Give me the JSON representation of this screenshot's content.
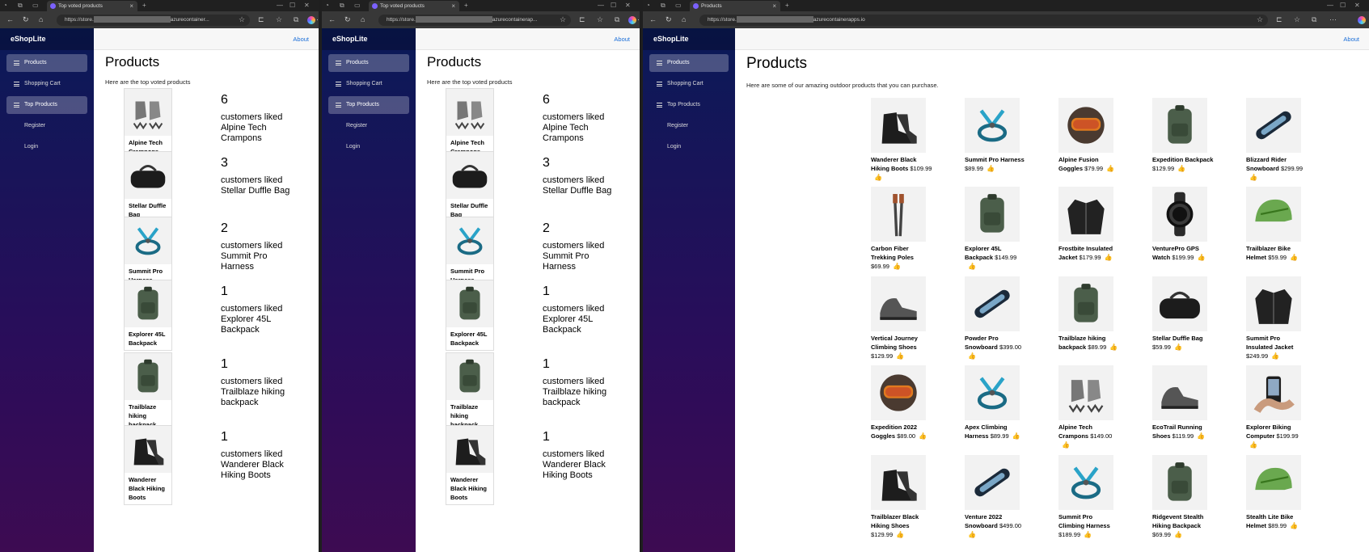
{
  "colors": {
    "accent": "#1a6ed8",
    "sidebar_top": "#0a1a58",
    "sidebar_bottom": "#3d0b52",
    "active_nav": "#4a4f86"
  },
  "windows": [
    {
      "tab_title": "Top voted products",
      "url_prefix": "https://store.",
      "url_suffix": "azurecontainer...",
      "brand": "eShopLite",
      "about": "About",
      "nav": [
        {
          "label": "Products",
          "icon": "menu-icon",
          "active": true
        },
        {
          "label": "Shopping Cart",
          "icon": "menu-icon",
          "active": false
        },
        {
          "label": "Top Products",
          "icon": "menu-icon",
          "active": true
        },
        {
          "label": "Register",
          "icon": "",
          "active": false
        },
        {
          "label": "Login",
          "icon": "",
          "active": false
        }
      ],
      "title": "Products",
      "subtitle": "Here are the top voted products",
      "top_voted": [
        {
          "name": "Alpine Tech Crampons",
          "count": "6",
          "liked_text": "customers liked"
        },
        {
          "name": "Stellar Duffle Bag",
          "count": "3",
          "liked_text": "customers liked"
        },
        {
          "name": "Summit Pro Harness",
          "count": "2",
          "liked_text": "customers liked"
        },
        {
          "name": "Explorer 45L Backpack",
          "count": "1",
          "liked_text": "customers liked"
        },
        {
          "name": "Trailblaze hiking backpack",
          "count": "1",
          "liked_text": "customers liked"
        },
        {
          "name": "Wanderer Black Hiking Boots",
          "count": "1",
          "liked_text": "customers liked"
        }
      ]
    },
    {
      "tab_title": "Top voted products",
      "url_prefix": "https://store.",
      "url_suffix": "azurecontainerap...",
      "brand": "eShopLite",
      "about": "About",
      "nav": [
        {
          "label": "Products",
          "icon": "menu-icon",
          "active": true
        },
        {
          "label": "Shopping Cart",
          "icon": "menu-icon",
          "active": false
        },
        {
          "label": "Top Products",
          "icon": "menu-icon",
          "active": true
        },
        {
          "label": "Register",
          "icon": "",
          "active": false
        },
        {
          "label": "Login",
          "icon": "",
          "active": false
        }
      ],
      "title": "Products",
      "subtitle": "Here are the top voted products",
      "top_voted": [
        {
          "name": "Alpine Tech Crampons",
          "count": "6",
          "liked_text": "customers liked"
        },
        {
          "name": "Stellar Duffle Bag",
          "count": "3",
          "liked_text": "customers liked"
        },
        {
          "name": "Summit Pro Harness",
          "count": "2",
          "liked_text": "customers liked"
        },
        {
          "name": "Explorer 45L Backpack",
          "count": "1",
          "liked_text": "customers liked"
        },
        {
          "name": "Trailblaze hiking backpack",
          "count": "1",
          "liked_text": "customers liked"
        },
        {
          "name": "Wanderer Black Hiking Boots",
          "count": "1",
          "liked_text": "customers liked"
        }
      ]
    },
    {
      "tab_title": "Products",
      "url_prefix": "https://store.",
      "url_suffix": "azurecontainerapps.io",
      "brand": "eShopLite",
      "about": "About",
      "nav": [
        {
          "label": "Products",
          "icon": "menu-icon",
          "active": true
        },
        {
          "label": "Shopping Cart",
          "icon": "menu-icon",
          "active": false
        },
        {
          "label": "Top Products",
          "icon": "menu-icon",
          "active": false
        },
        {
          "label": "Register",
          "icon": "",
          "active": false
        },
        {
          "label": "Login",
          "icon": "",
          "active": false
        }
      ],
      "title": "Products",
      "subtitle": "Here are some of our amazing outdoor products that you can purchase.",
      "products": [
        {
          "name": "Wanderer Black Hiking Boots",
          "price": "$109.99",
          "icon": "boots-icon"
        },
        {
          "name": "Summit Pro Harness",
          "price": "$89.99",
          "icon": "harness-icon"
        },
        {
          "name": "Alpine Fusion Goggles",
          "price": "$79.99",
          "icon": "goggles-icon"
        },
        {
          "name": "Expedition Backpack",
          "price": "$129.99",
          "icon": "backpack-icon"
        },
        {
          "name": "Blizzard Rider Snowboard",
          "price": "$299.99",
          "icon": "snowboard-icon"
        },
        {
          "name": "Carbon Fiber Trekking Poles",
          "price": "$69.99",
          "icon": "poles-icon"
        },
        {
          "name": "Explorer 45L Backpack",
          "price": "$149.99",
          "icon": "backpack-icon"
        },
        {
          "name": "Frostbite Insulated Jacket",
          "price": "$179.99",
          "icon": "jacket-icon"
        },
        {
          "name": "VenturePro GPS Watch",
          "price": "$199.99",
          "icon": "watch-icon"
        },
        {
          "name": "Trailblazer Bike Helmet",
          "price": "$59.99",
          "icon": "helmet-icon"
        },
        {
          "name": "Vertical Journey Climbing Shoes",
          "price": "$129.99",
          "icon": "shoe-icon"
        },
        {
          "name": "Powder Pro Snowboard",
          "price": "$399.00",
          "icon": "snowboard-icon"
        },
        {
          "name": "Trailblaze hiking backpack",
          "price": "$89.99",
          "icon": "backpack-icon"
        },
        {
          "name": "Stellar Duffle Bag",
          "price": "$59.99",
          "icon": "duffle-icon"
        },
        {
          "name": "Summit Pro Insulated Jacket",
          "price": "$249.99",
          "icon": "jacket-icon"
        },
        {
          "name": "Expedition 2022 Goggles",
          "price": "$89.00",
          "icon": "goggles-icon"
        },
        {
          "name": "Apex Climbing Harness",
          "price": "$89.99",
          "icon": "harness-icon"
        },
        {
          "name": "Alpine Tech Crampons",
          "price": "$149.00",
          "icon": "crampons-icon"
        },
        {
          "name": "EcoTrail Running Shoes",
          "price": "$119.99",
          "icon": "shoe-icon"
        },
        {
          "name": "Explorer Biking Computer",
          "price": "$199.99",
          "icon": "bike-computer-icon"
        },
        {
          "name": "Trailblazer Black Hiking Shoes",
          "price": "$129.99",
          "icon": "boots-icon"
        },
        {
          "name": "Venture 2022 Snowboard",
          "price": "$499.00",
          "icon": "snowboard-icon"
        },
        {
          "name": "Summit Pro Climbing Harness",
          "price": "$189.99",
          "icon": "harness-icon"
        },
        {
          "name": "Ridgevent Stealth Hiking Backpack",
          "price": "$69.99",
          "icon": "backpack-icon"
        },
        {
          "name": "Stealth Lite Bike Helmet",
          "price": "$89.99",
          "icon": "helmet-icon"
        }
      ]
    }
  ]
}
